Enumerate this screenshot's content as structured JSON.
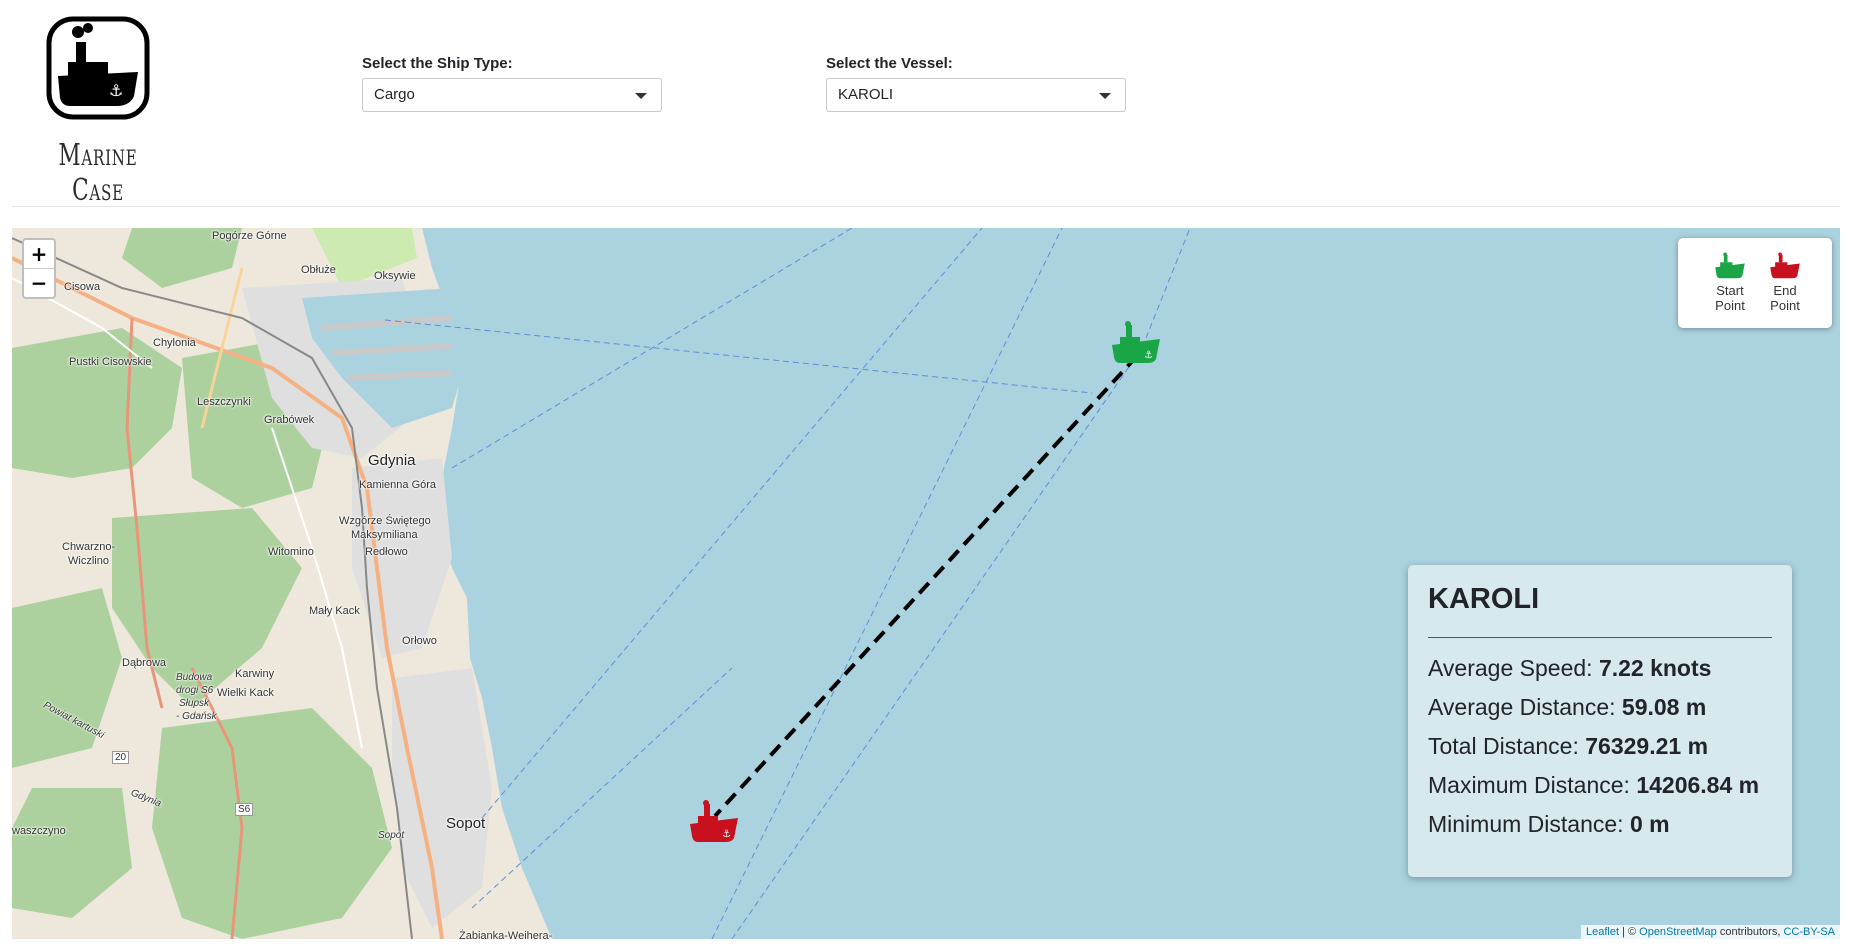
{
  "brand": {
    "name": "Marine Case",
    "logo_icon": "ship-logo-icon"
  },
  "filters": {
    "ship_type": {
      "label": "Select the Ship Type:",
      "value": "Cargo"
    },
    "vessel": {
      "label": "Select the Vessel:",
      "value": "KAROLI"
    }
  },
  "map": {
    "zoom_in": "+",
    "zoom_out": "−",
    "legend": {
      "start": {
        "line1": "Start",
        "line2": "Point",
        "color": "#1aa547",
        "icon": "ship-start-icon"
      },
      "end": {
        "line1": "End",
        "line2": "Point",
        "color": "#c8101e",
        "icon": "ship-end-icon"
      }
    },
    "places": {
      "pogorze_gorne": "Pogórze Górne",
      "obluze": "Obłuże",
      "oksywie": "Oksywie",
      "cisowa": "Cisowa",
      "chylonia": "Chylonia",
      "pustki": "Pustki Cisowskie",
      "leszczynki": "Leszczynki",
      "grabowek": "Grabówek",
      "gdynia": "Gdynia",
      "kamienna": "Kamienna Góra",
      "wzgorze1": "Wzgórze Świętego",
      "wzgorze2": "Maksymiliana",
      "redlowo": "Redłowo",
      "chwarzno1": "Chwarzno-",
      "chwarzno2": "Wiczlino",
      "witomino": "Witomino",
      "maly_kack": "Mały Kack",
      "orlowo": "Orłowo",
      "dabrowa": "Dąbrowa",
      "karwiny": "Karwiny",
      "wielki_kack": "Wielki Kack",
      "budowa1": "Budowa",
      "budowa2": "drogi S6",
      "budowa3": "Słupsk",
      "budowa4": "- Gdańsk",
      "powiat": "Powiat kartuski",
      "sopot": "Sopot",
      "sopot_park": "Sopot",
      "gdynia_label": "Gdynia",
      "waszczyno": "waszczyno",
      "zabianka": "Żabianka-Wejhera-",
      "road_20": "20",
      "road_s6": "S6"
    },
    "attribution": {
      "leaflet": "Leaflet",
      "sep": " | © ",
      "osm": "OpenStreetMap",
      "contrib": " contributors, ",
      "license": "CC-BY-SA"
    }
  },
  "info": {
    "vessel_name": "KAROLI",
    "stats": [
      {
        "label": "Average Speed: ",
        "value": "7.22 knots"
      },
      {
        "label": "Average Distance: ",
        "value": "59.08 m"
      },
      {
        "label": "Total Distance: ",
        "value": "76329.21 m"
      },
      {
        "label": "Maximum Distance: ",
        "value": "14206.84 m"
      },
      {
        "label": "Minimum Distance: ",
        "value": "0 m"
      }
    ]
  }
}
